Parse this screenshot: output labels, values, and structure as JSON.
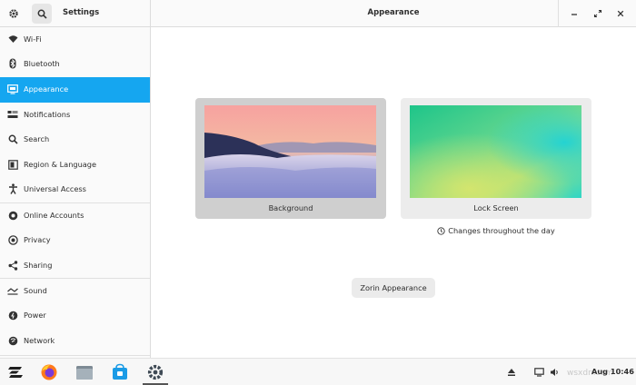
{
  "header": {
    "app_title": "Settings",
    "page_title": "Appearance"
  },
  "sidebar": {
    "items": [
      {
        "label": "Wi-Fi",
        "icon": "wifi-icon"
      },
      {
        "label": "Bluetooth",
        "icon": "bluetooth-icon"
      },
      {
        "label": "Appearance",
        "icon": "appearance-icon",
        "active": true
      },
      {
        "label": "Notifications",
        "icon": "notifications-icon"
      },
      {
        "label": "Search",
        "icon": "search-icon"
      },
      {
        "label": "Region & Language",
        "icon": "region-icon"
      },
      {
        "label": "Universal Access",
        "icon": "accessibility-icon"
      },
      {
        "label": "Online Accounts",
        "icon": "online-accounts-icon"
      },
      {
        "label": "Privacy",
        "icon": "privacy-icon"
      },
      {
        "label": "Sharing",
        "icon": "sharing-icon"
      },
      {
        "label": "Sound",
        "icon": "sound-icon"
      },
      {
        "label": "Power",
        "icon": "power-icon"
      },
      {
        "label": "Network",
        "icon": "network-icon"
      }
    ]
  },
  "main": {
    "background_label": "Background",
    "lock_screen_label": "Lock Screen",
    "changes_text": "Changes throughout the day",
    "zorin_button": "Zorin Appearance"
  },
  "taskbar": {
    "clock": "Aug 10:46",
    "watermark": "wsxdn.com",
    "apps": [
      "zorin-menu-icon",
      "firefox-icon",
      "files-icon",
      "software-store-icon",
      "settings-icon"
    ]
  },
  "colors": {
    "accent": "#15a6f0"
  }
}
